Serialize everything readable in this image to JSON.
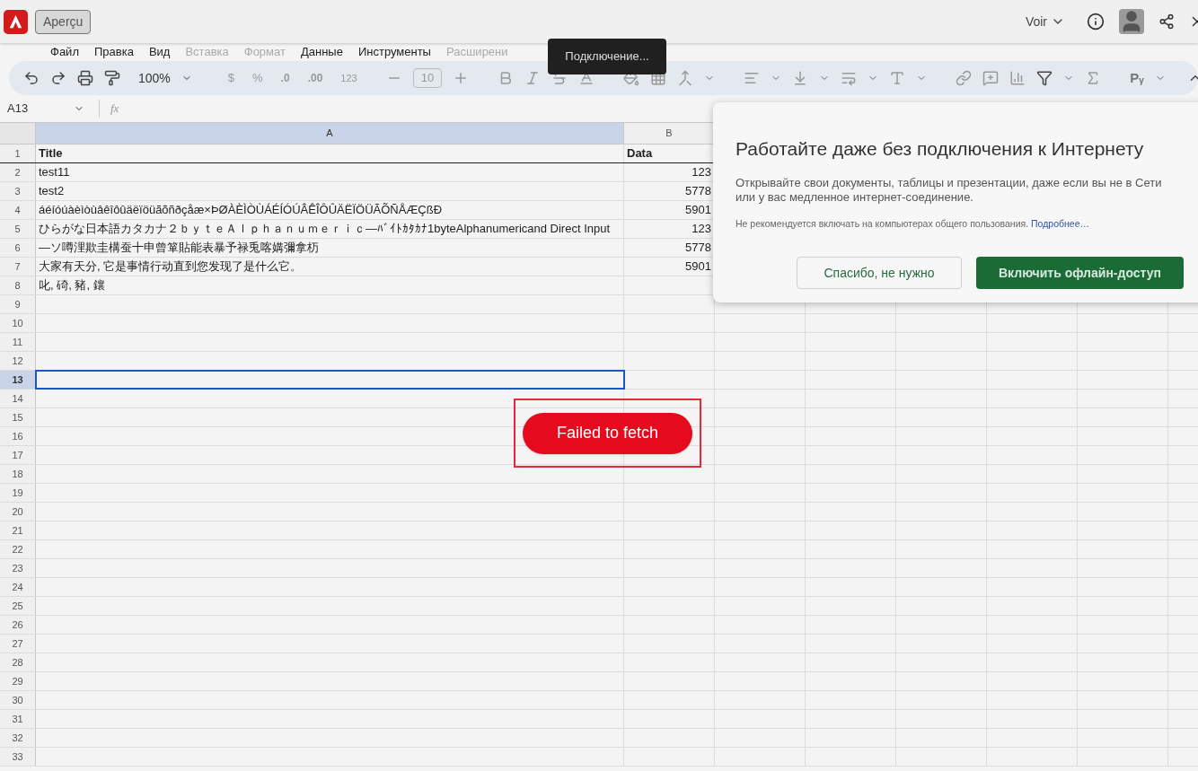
{
  "top_bar": {
    "preview_button": "Aperçu",
    "view_menu": "Voir"
  },
  "menu": [
    {
      "label": "Файл",
      "disabled": false
    },
    {
      "label": "Правка",
      "disabled": false
    },
    {
      "label": "Вид",
      "disabled": false
    },
    {
      "label": "Вставка",
      "disabled": true
    },
    {
      "label": "Формат",
      "disabled": true
    },
    {
      "label": "Данные",
      "disabled": false
    },
    {
      "label": "Инструменты",
      "disabled": false
    },
    {
      "label": "Расширени",
      "disabled": true
    }
  ],
  "tooltip": "Подключение...",
  "toolbar": {
    "zoom": "100%",
    "currency": "$",
    "percent": "%",
    "decrease_decimals": ".0",
    "increase_decimals": ".00",
    "number_format": "123",
    "font_size": "10",
    "script": "Pᵧ"
  },
  "formula_bar": {
    "name_box": "A13",
    "fx": "fx"
  },
  "sheet": {
    "columns": [
      {
        "label": "A",
        "selected": true
      },
      {
        "label": "B",
        "selected": false
      }
    ],
    "rows": [
      {
        "number": "1",
        "selected": false,
        "kind": "header",
        "cells": [
          "Title",
          "Data"
        ]
      },
      {
        "number": "2",
        "selected": false,
        "kind": "data",
        "cells": [
          "test11",
          "123"
        ]
      },
      {
        "number": "3",
        "selected": false,
        "kind": "data",
        "cells": [
          "test2",
          "5778"
        ]
      },
      {
        "number": "4",
        "selected": false,
        "kind": "data",
        "cells": [
          "áéíóúàèìòùâêîôûäëïöüãõñðçåæ×ÞØÀÈÌÒÙÁÉÍÓÚÂÊÎÔÛÄËÏÖÜÃÕÑÅÆÇßÐ",
          "5901"
        ]
      },
      {
        "number": "5",
        "selected": false,
        "kind": "data",
        "cells": [
          "ひらがな日本語カタカナ２ｂｙｔｅＡｌｐｈａｎｕｍｅｒｉｃ—ﾊﾞｲﾄｶﾀｶﾅ1byteAlphanumericand Direct Input",
          "123"
        ]
      },
      {
        "number": "6",
        "selected": false,
        "kind": "data",
        "cells": [
          "―ソ噂浬欺圭構蚕十申曾箪貼能表暴予禄兎喀媾彌拿杤",
          "5778"
        ]
      },
      {
        "number": "7",
        "selected": false,
        "kind": "data",
        "cells": [
          "大家有天分, 它是事情行动直到您发现了是什么它。",
          "5901"
        ]
      },
      {
        "number": "8",
        "selected": false,
        "kind": "data",
        "cells": [
          "叱, 碕, 豬, 鑲"
        ]
      },
      {
        "number": "9",
        "selected": false,
        "kind": "data"
      },
      {
        "number": "10",
        "selected": false,
        "kind": "data"
      },
      {
        "number": "11",
        "selected": false,
        "kind": "data"
      },
      {
        "number": "12",
        "selected": false,
        "kind": "data"
      },
      {
        "number": "13",
        "selected": true,
        "kind": "data"
      },
      {
        "number": "14",
        "selected": false,
        "kind": "data"
      },
      {
        "number": "15",
        "selected": false,
        "kind": "data"
      },
      {
        "number": "16",
        "selected": false,
        "kind": "data"
      },
      {
        "number": "17",
        "selected": false,
        "kind": "data"
      },
      {
        "number": "18",
        "selected": false,
        "kind": "data"
      },
      {
        "number": "19",
        "selected": false,
        "kind": "data"
      },
      {
        "number": "20",
        "selected": false,
        "kind": "data"
      },
      {
        "number": "21",
        "selected": false,
        "kind": "data"
      },
      {
        "number": "22",
        "selected": false,
        "kind": "data"
      },
      {
        "number": "23",
        "selected": false,
        "kind": "data"
      },
      {
        "number": "24",
        "selected": false,
        "kind": "data"
      },
      {
        "number": "25",
        "selected": false,
        "kind": "data"
      },
      {
        "number": "26",
        "selected": false,
        "kind": "data"
      },
      {
        "number": "27",
        "selected": false,
        "kind": "data"
      },
      {
        "number": "28",
        "selected": false,
        "kind": "data"
      },
      {
        "number": "29",
        "selected": false,
        "kind": "data"
      },
      {
        "number": "30",
        "selected": false,
        "kind": "data"
      },
      {
        "number": "31",
        "selected": false,
        "kind": "data"
      },
      {
        "number": "32",
        "selected": false,
        "kind": "data"
      },
      {
        "number": "33",
        "selected": false,
        "kind": "data"
      }
    ]
  },
  "offline_dialog": {
    "title": "Работайте даже без подключения к Интернету",
    "body": "Открывайте свои документы, таблицы и презентации, даже если вы не в Сети или у вас медленное интернет-соединение.",
    "note": "Не рекомендуется включать на компьютерах общего пользования.",
    "link": "Подробнее…",
    "buttons": [
      {
        "label": "Спасибо, не нужно",
        "kind": "secondary"
      },
      {
        "label": "Включить офлайн-доступ",
        "kind": "primary"
      }
    ]
  },
  "error_toast": {
    "message": "Failed to fetch",
    "highlighted": true
  }
}
